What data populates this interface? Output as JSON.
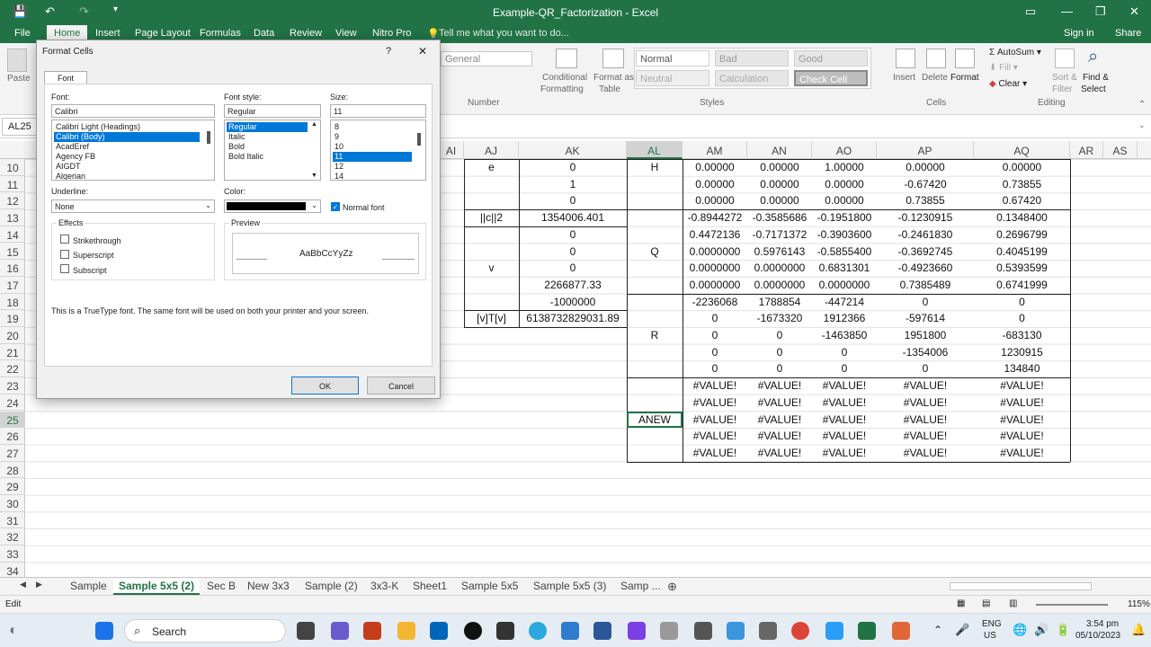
{
  "app": {
    "title": "Example-QR_Factorization - Excel",
    "signin": "Sign in",
    "share": "Share"
  },
  "menu": [
    "File",
    "Home",
    "Insert",
    "Page Layout",
    "Formulas",
    "Data",
    "Review",
    "View",
    "Nitro Pro"
  ],
  "tellme": "Tell me what you want to do...",
  "ribbon": {
    "paste": "Paste",
    "number_format": "General",
    "number_lbl": "Number",
    "cond_fmt1": "Conditional",
    "cond_fmt2": "Formatting",
    "fmt_tbl1": "Format as",
    "fmt_tbl2": "Table",
    "styles": [
      "Normal",
      "Bad",
      "Good",
      "Neutral",
      "Calculation",
      "Check Cell"
    ],
    "styles_lbl": "Styles",
    "insert": "Insert",
    "delete": "Delete",
    "format": "Format",
    "cells_lbl": "Cells",
    "autosum": "AutoSum",
    "fill": "Fill",
    "clear": "Clear",
    "sort1": "Sort &",
    "sort2": "Filter",
    "find1": "Find &",
    "find2": "Select",
    "editing_lbl": "Editing"
  },
  "namebox": "AL25",
  "columns": [
    "AI",
    "AJ",
    "AK",
    "AL",
    "AM",
    "AN",
    "AO",
    "AP",
    "AQ",
    "AR",
    "AS"
  ],
  "rows": [
    "10",
    "11",
    "12",
    "13",
    "14",
    "15",
    "16",
    "17",
    "18",
    "19",
    "20",
    "21",
    "22",
    "23",
    "24",
    "25",
    "26",
    "27",
    "28",
    "29",
    "30",
    "31",
    "32",
    "33",
    "34"
  ],
  "cells": {
    "aj": [
      "e",
      "",
      "",
      "||c||2",
      "",
      "",
      "v",
      "",
      "",
      "[v]T[v]"
    ],
    "ak": [
      "0",
      "1",
      "0",
      "1354006.401",
      "0",
      "0",
      "0",
      "2266877.33",
      "-1000000",
      "6138732829031.89"
    ],
    "al": {
      "H": "H",
      "Q": "Q",
      "R": "R",
      "ANEW": "ANEW"
    },
    "mat": [
      [
        "0.00000",
        "0.00000",
        "1.00000",
        "0.00000",
        "0.00000"
      ],
      [
        "0.00000",
        "0.00000",
        "0.00000",
        "-0.67420",
        "0.73855"
      ],
      [
        "0.00000",
        "0.00000",
        "0.00000",
        "0.73855",
        "0.67420"
      ],
      [
        "-0.8944272",
        "-0.3585686",
        "-0.1951800",
        "-0.1230915",
        "0.1348400"
      ],
      [
        "0.4472136",
        "-0.7171372",
        "-0.3903600",
        "-0.2461830",
        "0.2696799"
      ],
      [
        "0.0000000",
        "0.5976143",
        "-0.5855400",
        "-0.3692745",
        "0.4045199"
      ],
      [
        "0.0000000",
        "0.0000000",
        "0.6831301",
        "-0.4923660",
        "0.5393599"
      ],
      [
        "0.0000000",
        "0.0000000",
        "0.0000000",
        "0.7385489",
        "0.6741999"
      ],
      [
        "-2236068",
        "1788854",
        "-447214",
        "0",
        "0"
      ],
      [
        "0",
        "-1673320",
        "1912366",
        "-597614",
        "0"
      ],
      [
        "0",
        "0",
        "-1463850",
        "1951800",
        "-683130"
      ],
      [
        "0",
        "0",
        "0",
        "-1354006",
        "1230915"
      ],
      [
        "0",
        "0",
        "0",
        "0",
        "134840"
      ],
      [
        "#VALUE!",
        "#VALUE!",
        "#VALUE!",
        "#VALUE!",
        "#VALUE!"
      ],
      [
        "#VALUE!",
        "#VALUE!",
        "#VALUE!",
        "#VALUE!",
        "#VALUE!"
      ],
      [
        "#VALUE!",
        "#VALUE!",
        "#VALUE!",
        "#VALUE!",
        "#VALUE!"
      ],
      [
        "#VALUE!",
        "#VALUE!",
        "#VALUE!",
        "#VALUE!",
        "#VALUE!"
      ],
      [
        "#VALUE!",
        "#VALUE!",
        "#VALUE!",
        "#VALUE!",
        "#VALUE!"
      ]
    ]
  },
  "sheets": [
    "Sample",
    "Sample 5x5 (2)",
    "Sec B",
    "New 3x3",
    "Sample (2)",
    "3x3-K",
    "Sheet1",
    "Sample 5x5",
    "Sample 5x5 (3)",
    "Samp ..."
  ],
  "status": {
    "mode": "Edit",
    "zoom": "115%"
  },
  "taskbar": {
    "search": "Search",
    "lang1": "ENG",
    "lang2": "US",
    "time": "3:54 pm",
    "date": "05/10/2023"
  },
  "dialog": {
    "title": "Format Cells",
    "help": "?",
    "close": "✕",
    "tab": "Font",
    "font_lbl": "Font:",
    "font_val": "Calibri",
    "fonts": [
      "Calibri Light (Headings)",
      "Calibri (Body)",
      "AcadEref",
      "Agency FB",
      "AIGDT",
      "Algerian"
    ],
    "style_lbl": "Font style:",
    "style_val": "Regular",
    "styles": [
      "Regular",
      "Italic",
      "Bold",
      "Bold Italic"
    ],
    "size_lbl": "Size:",
    "size_val": "11",
    "sizes": [
      "8",
      "9",
      "10",
      "11",
      "12",
      "14"
    ],
    "underline_lbl": "Underline:",
    "underline_val": "None",
    "color_lbl": "Color:",
    "normal_font": "Normal font",
    "effects_lbl": "Effects",
    "strike": "Strikethrough",
    "super": "Superscript",
    "sub": "Subscript",
    "preview_lbl": "Preview",
    "preview_text": "AaBbCcYyZz",
    "note": "This is a TrueType font.  The same font will be used on both your printer and your screen.",
    "ok": "OK",
    "cancel": "Cancel"
  }
}
